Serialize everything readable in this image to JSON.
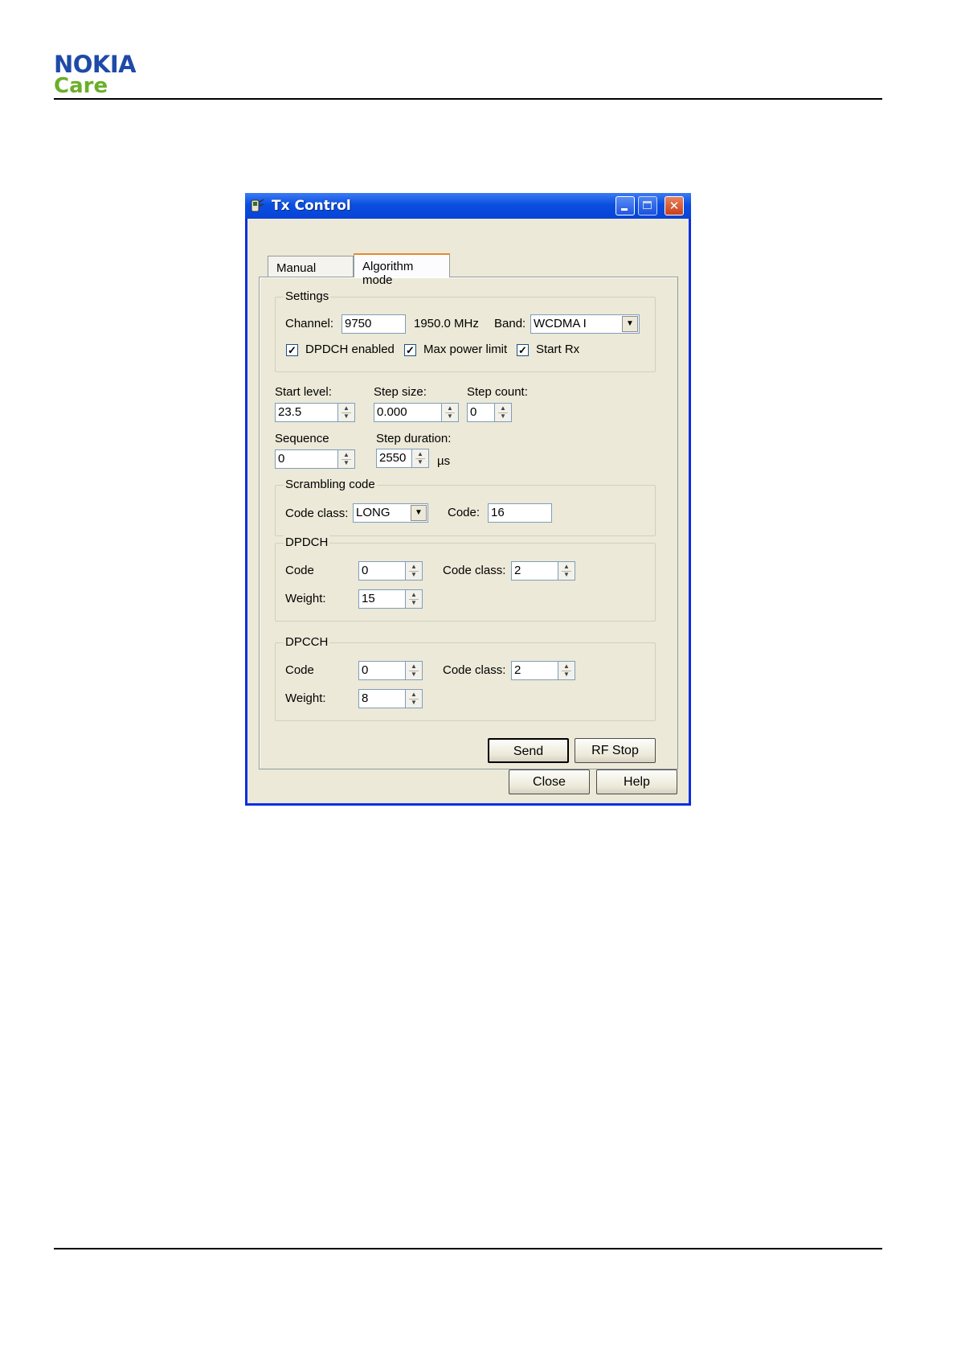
{
  "page": {
    "logo_nokia": "NOKIA",
    "logo_care": "Care"
  },
  "window": {
    "title": "Tx Control",
    "controls": {
      "minimize": "minimize",
      "maximize": "maximize",
      "close": "✕"
    }
  },
  "tabs": [
    {
      "label": "Manual mode",
      "active": false
    },
    {
      "label": "Algorithm mode",
      "active": true
    }
  ],
  "settings": {
    "title": "Settings",
    "channel_label": "Channel:",
    "channel_value": "9750",
    "frequency": "1950.0 MHz",
    "band_label": "Band:",
    "band_value": "WCDMA I",
    "dpdch_enabled_label": "DPDCH enabled",
    "dpdch_enabled": true,
    "max_power_label": "Max power limit",
    "max_power": true,
    "start_rx_label": "Start Rx",
    "start_rx": true
  },
  "sweep": {
    "start_level_label": "Start level:",
    "start_level_value": "23.5",
    "step_size_label": "Step size:",
    "step_size_value": "0.000",
    "step_count_label": "Step count:",
    "step_count_value": "0",
    "sequence_label": "Sequence",
    "sequence_value": "0",
    "step_duration_label": "Step duration:",
    "step_duration_value": "2550",
    "step_duration_unit": "µs"
  },
  "scrambling": {
    "title": "Scrambling code",
    "code_class_label": "Code class:",
    "code_class_value": "LONG",
    "code_label": "Code:",
    "code_value": "16"
  },
  "dpdch": {
    "title": "DPDCH",
    "code_label": "Code",
    "code_value": "0",
    "code_class_label": "Code class:",
    "code_class_value": "2",
    "weight_label": "Weight:",
    "weight_value": "15"
  },
  "dpcch": {
    "title": "DPCCH",
    "code_label": "Code",
    "code_value": "0",
    "code_class_label": "Code class:",
    "code_class_value": "2",
    "weight_label": "Weight:",
    "weight_value": "8"
  },
  "buttons": {
    "send": "Send",
    "rf_stop": "RF Stop",
    "close": "Close",
    "help": "Help"
  }
}
